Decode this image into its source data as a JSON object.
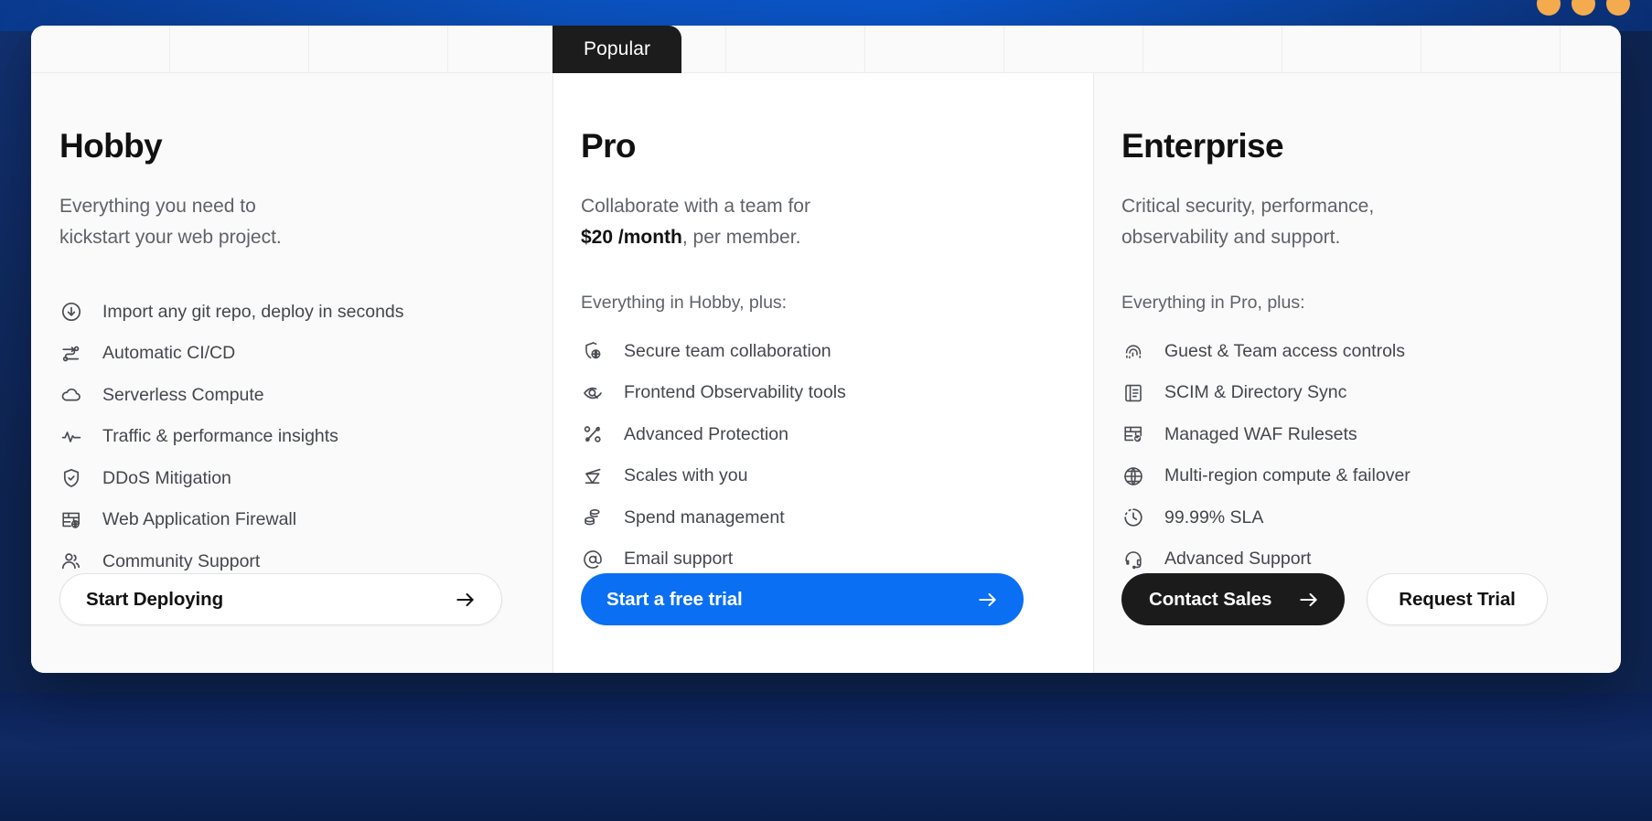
{
  "window": {
    "dots": [
      "dot-1",
      "dot-2",
      "dot-3"
    ],
    "dot_color": "#f4ab4e",
    "background_color": "#0e2451",
    "band_color": "#0b52bf"
  },
  "badge": {
    "label": "Popular",
    "background": "#1c1c1c",
    "text_color": "#ffffff"
  },
  "grid": {
    "cell_count": 12
  },
  "plans": [
    {
      "id": "hobby",
      "name": "Hobby",
      "description_line1": "Everything you need to",
      "description_line2": "kickstart your web project.",
      "includes_note": "",
      "features": [
        {
          "icon": "download-circle-icon",
          "label": "Import any git repo, deploy in seconds"
        },
        {
          "icon": "ci-cd-branch-icon",
          "label": "Automatic CI/CD"
        },
        {
          "icon": "cloud-icon",
          "label": "Serverless Compute"
        },
        {
          "icon": "activity-pulse-icon",
          "label": "Traffic & performance insights"
        },
        {
          "icon": "shield-check-icon",
          "label": "DDoS Mitigation"
        },
        {
          "icon": "firewall-globe-icon",
          "label": "Web Application Firewall"
        },
        {
          "icon": "users-icon",
          "label": "Community Support"
        }
      ],
      "buttons": [
        {
          "id": "start-deploying",
          "label": "Start Deploying",
          "style": "outline",
          "has_arrow": true
        }
      ]
    },
    {
      "id": "pro",
      "name": "Pro",
      "description_line1": "Collaborate with a team for",
      "price": "$20 /month",
      "description_line2_suffix": ", per member.",
      "includes_note": "Everything in Hobby, plus:",
      "features": [
        {
          "icon": "shield-globe-icon",
          "label": "Secure team collaboration"
        },
        {
          "icon": "eye-search-icon",
          "label": "Frontend Observability tools"
        },
        {
          "icon": "advanced-protection-icon",
          "label": "Advanced Protection"
        },
        {
          "icon": "scales-icon",
          "label": "Scales with you"
        },
        {
          "icon": "coins-icon",
          "label": "Spend management"
        },
        {
          "icon": "at-sign-icon",
          "label": "Email support"
        }
      ],
      "buttons": [
        {
          "id": "start-free-trial",
          "label": "Start a free trial",
          "style": "primary",
          "has_arrow": true,
          "color": "#0a6ff2"
        }
      ]
    },
    {
      "id": "enterprise",
      "name": "Enterprise",
      "description_line1": "Critical security, performance,",
      "description_line2": "observability and support.",
      "includes_note": "Everything in Pro, plus:",
      "features": [
        {
          "icon": "fingerprint-icon",
          "label": "Guest & Team access controls"
        },
        {
          "icon": "directory-book-icon",
          "label": "SCIM & Directory Sync"
        },
        {
          "icon": "waf-check-icon",
          "label": "Managed WAF Rulesets"
        },
        {
          "icon": "globe-icon",
          "label": "Multi-region compute & failover"
        },
        {
          "icon": "clock-dashed-icon",
          "label": "99.99% SLA"
        },
        {
          "icon": "headset-icon",
          "label": "Advanced Support"
        }
      ],
      "buttons": [
        {
          "id": "contact-sales",
          "label": "Contact Sales",
          "style": "dark",
          "has_arrow": true
        },
        {
          "id": "request-trial",
          "label": "Request Trial",
          "style": "ghost",
          "has_arrow": false
        }
      ]
    }
  ]
}
